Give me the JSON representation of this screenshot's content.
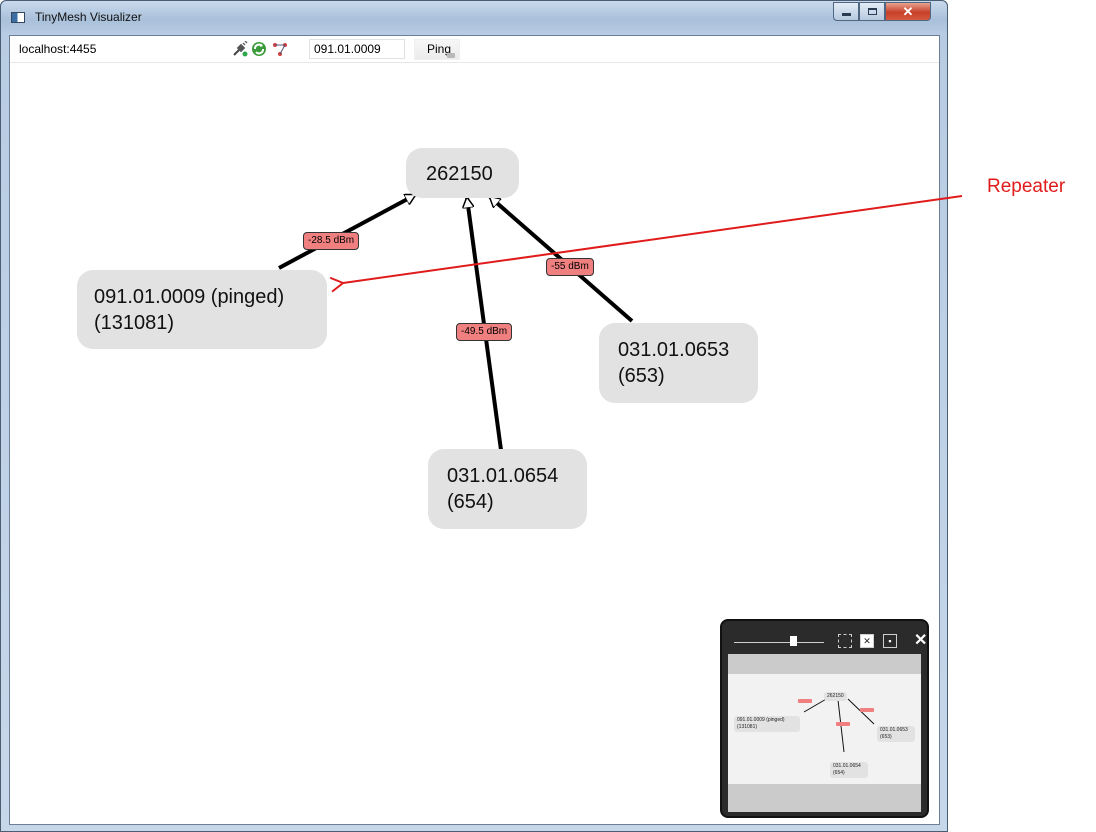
{
  "window": {
    "title": "TinyMesh Visualizer",
    "icons": {
      "app": "window-app-icon",
      "minimize": "minimize-icon",
      "maximize": "maximize-icon",
      "close": "close-icon"
    }
  },
  "toolbar": {
    "host": "localhost:4455",
    "icons": [
      "disconnect-plug-icon",
      "refresh-icon",
      "network-route-icon"
    ],
    "address": "091.01.0009",
    "ping_label": "Ping"
  },
  "graph": {
    "nodes": {
      "root": {
        "line1": "262150"
      },
      "n1": {
        "line1": "091.01.0009 (pinged)",
        "line2": "(131081)"
      },
      "n2": {
        "line1": "031.01.0653",
        "line2": "(653)"
      },
      "n3": {
        "line1": "031.01.0654",
        "line2": "(654)"
      }
    },
    "edges": {
      "e1": "-28.5 dBm",
      "e2": "-55 dBm",
      "e3": "-49.5 dBm"
    },
    "colors": {
      "node_fill": "#e2e2e2",
      "label_fill": "#f08080",
      "edge": "#000000",
      "annotation": "#e01b1b"
    }
  },
  "annotation": {
    "text": "Repeater"
  },
  "minimap": {
    "buttons": [
      "fit-icon",
      "zoom-extent-icon",
      "center-icon",
      "close-icon"
    ],
    "close": "✕"
  }
}
